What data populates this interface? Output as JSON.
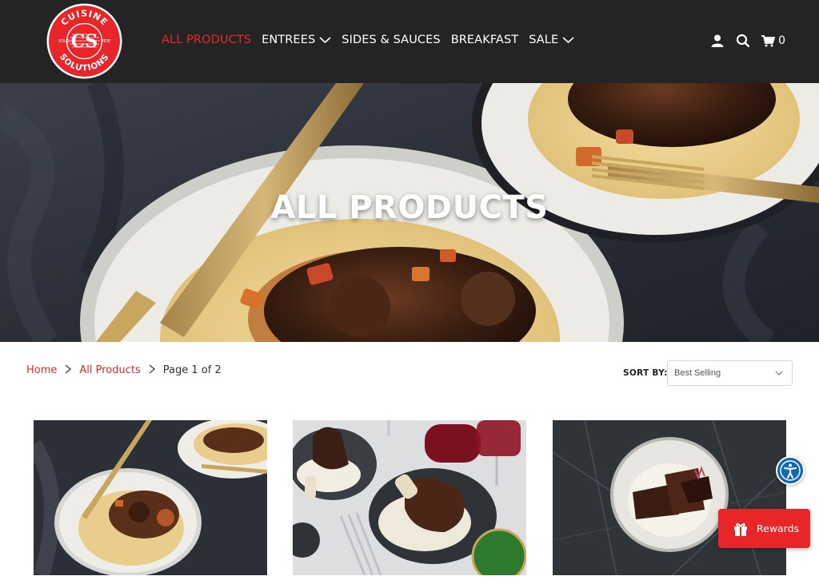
{
  "logo": {
    "top_text": "CUISINE",
    "bottom_text": "SOLUTIONS",
    "left_text": "SOUS",
    "right_text": "VIDE",
    "monogram": "CS",
    "color": "#e8262a"
  },
  "nav": {
    "items": [
      {
        "label": "ALL PRODUCTS",
        "active": true
      },
      {
        "label": "ENTREES",
        "dropdown": true
      },
      {
        "label": "SIDES & SAUCES"
      },
      {
        "label": "BREAKFAST"
      },
      {
        "label": "SALE",
        "dropdown": true
      }
    ]
  },
  "header_icons": {
    "account": "user-icon",
    "search": "search-icon",
    "cart": "cart-icon",
    "cart_count": "0"
  },
  "hero": {
    "title": "ALL PRODUCTS"
  },
  "breadcrumb": {
    "home": "Home",
    "all_products": "All Products",
    "current": "Page 1 of 2"
  },
  "sort": {
    "label": "SORT BY:",
    "selected": "Best Selling"
  },
  "rewards": {
    "label": "Rewards",
    "icon": "gift-icon"
  },
  "accessibility": {
    "icon": "accessibility-icon"
  },
  "colors": {
    "header_bg": "#242424",
    "accent_red": "#e32b2b"
  }
}
